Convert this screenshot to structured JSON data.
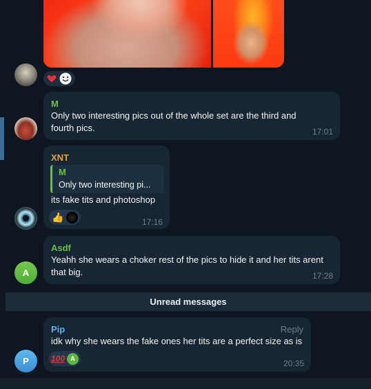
{
  "messages": [
    {
      "sender": "M",
      "sender_color": "#6fbf4a",
      "text": "Only two interesting pics out of the whole set are the third and fourth pics.",
      "time": "17:01"
    },
    {
      "sender": "XNT",
      "sender_color": "#e6a23c",
      "quote_sender": "M",
      "quote_text": "Only two interesting pi...",
      "text": "its fake tits and photoshop",
      "time": "17:16",
      "reactions": [
        "thumbs-up",
        "dark-circle"
      ]
    },
    {
      "sender": "Asdf",
      "sender_color": "#6fbf4a",
      "avatar_letter": "A",
      "text": "Yeahh she wears a choker rest of the pics to hide it and her tits arent that big.",
      "time": "17:28"
    },
    {
      "sender": "Pip",
      "sender_color": "#5fb3e8",
      "avatar_letter": "P",
      "reply_label": "Reply",
      "text": "idk why she wears the fake ones her tits are a perfect size as is",
      "time": "20:35",
      "reactions": [
        "hundred-points",
        "avatar-a"
      ]
    }
  ],
  "photo_reactions": [
    "red-heart",
    "smiling-face"
  ],
  "unread_label": "Unread messages"
}
